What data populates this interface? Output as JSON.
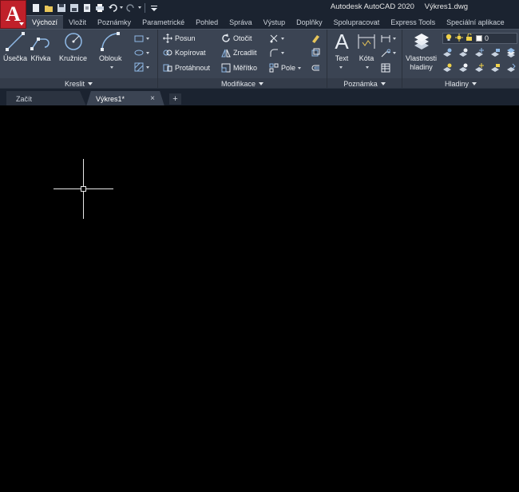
{
  "title": {
    "app": "Autodesk AutoCAD 2020",
    "file": "Výkres1.dwg"
  },
  "app_button": {
    "letter": "A"
  },
  "ribbon_tabs": [
    "Výchozí",
    "Vložit",
    "Poznámky",
    "Parametrické",
    "Pohled",
    "Správa",
    "Výstup",
    "Doplňky",
    "Spolupracovat",
    "Express Tools",
    "Speciální aplikace"
  ],
  "panels": {
    "draw": {
      "title": "Kreslit",
      "line": "Úsečka",
      "polyline": "Křivka",
      "circle": "Kružnice",
      "arc": "Oblouk"
    },
    "modify": {
      "title": "Modifikace",
      "move": "Posun",
      "copy": "Kopírovat",
      "stretch": "Protáhnout",
      "rotate": "Otočit",
      "mirror": "Zrcadlit",
      "scale": "Měřítko",
      "array": "Pole"
    },
    "annotation": {
      "title": "Poznámka",
      "text": "Text",
      "dimension": "Kóta"
    },
    "layers": {
      "title": "Hladiny",
      "properties": "Vlastnosti",
      "properties2": "hladiny",
      "current_layer": "0"
    }
  },
  "doc_tabs": {
    "start": "Začít",
    "drawing": "Výkres1*",
    "close": "×",
    "add": "+"
  },
  "colors": {
    "accent_red": "#c0202a",
    "ribbon_bg": "#3b4453",
    "titlebar_bg": "#1b2330",
    "canvas_bg": "#000000"
  }
}
